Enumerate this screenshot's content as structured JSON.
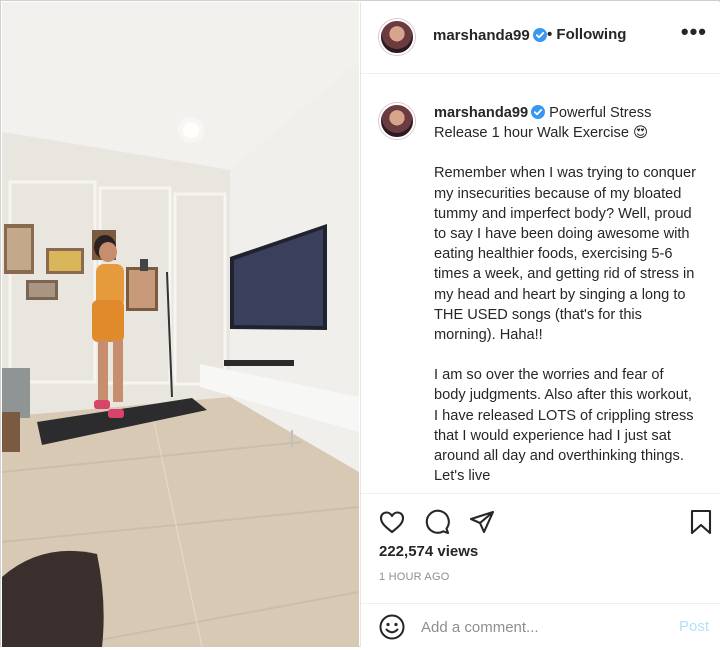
{
  "post": {
    "username": "marshanda99",
    "follow_status": "• Following",
    "more_label": "•••",
    "caption_title": "Powerful Stress Release 1 hour Walk Exercise 😍",
    "caption_paragraphs": [
      "Remember when I was trying to conquer my insecurities because of my bloated tummy and imperfect body? Well, proud to say I have been doing awesome with eating healthier foods, exercising 5-6 times a week, and getting rid of stress in my head and heart by singing a long to THE USED songs (that's for this morning). Haha!!",
      "I am so over the worries and fear of body judgments. Also after this workout, I have released LOTS of crippling stress that I would experience had I just sat around all day and overthinking things. Let's live"
    ],
    "views": "222,574 views",
    "time_ago": "1 HOUR AGO"
  },
  "comment": {
    "placeholder": "Add a comment...",
    "post_label": "Post"
  },
  "icons": [
    "heart-icon",
    "comment-icon",
    "share-icon",
    "bookmark-icon",
    "emoji-icon",
    "verified-badge-icon"
  ],
  "colors": {
    "verified": "#3897f0",
    "post_disabled": "#b2dffc",
    "muted": "#8e8e8e"
  }
}
